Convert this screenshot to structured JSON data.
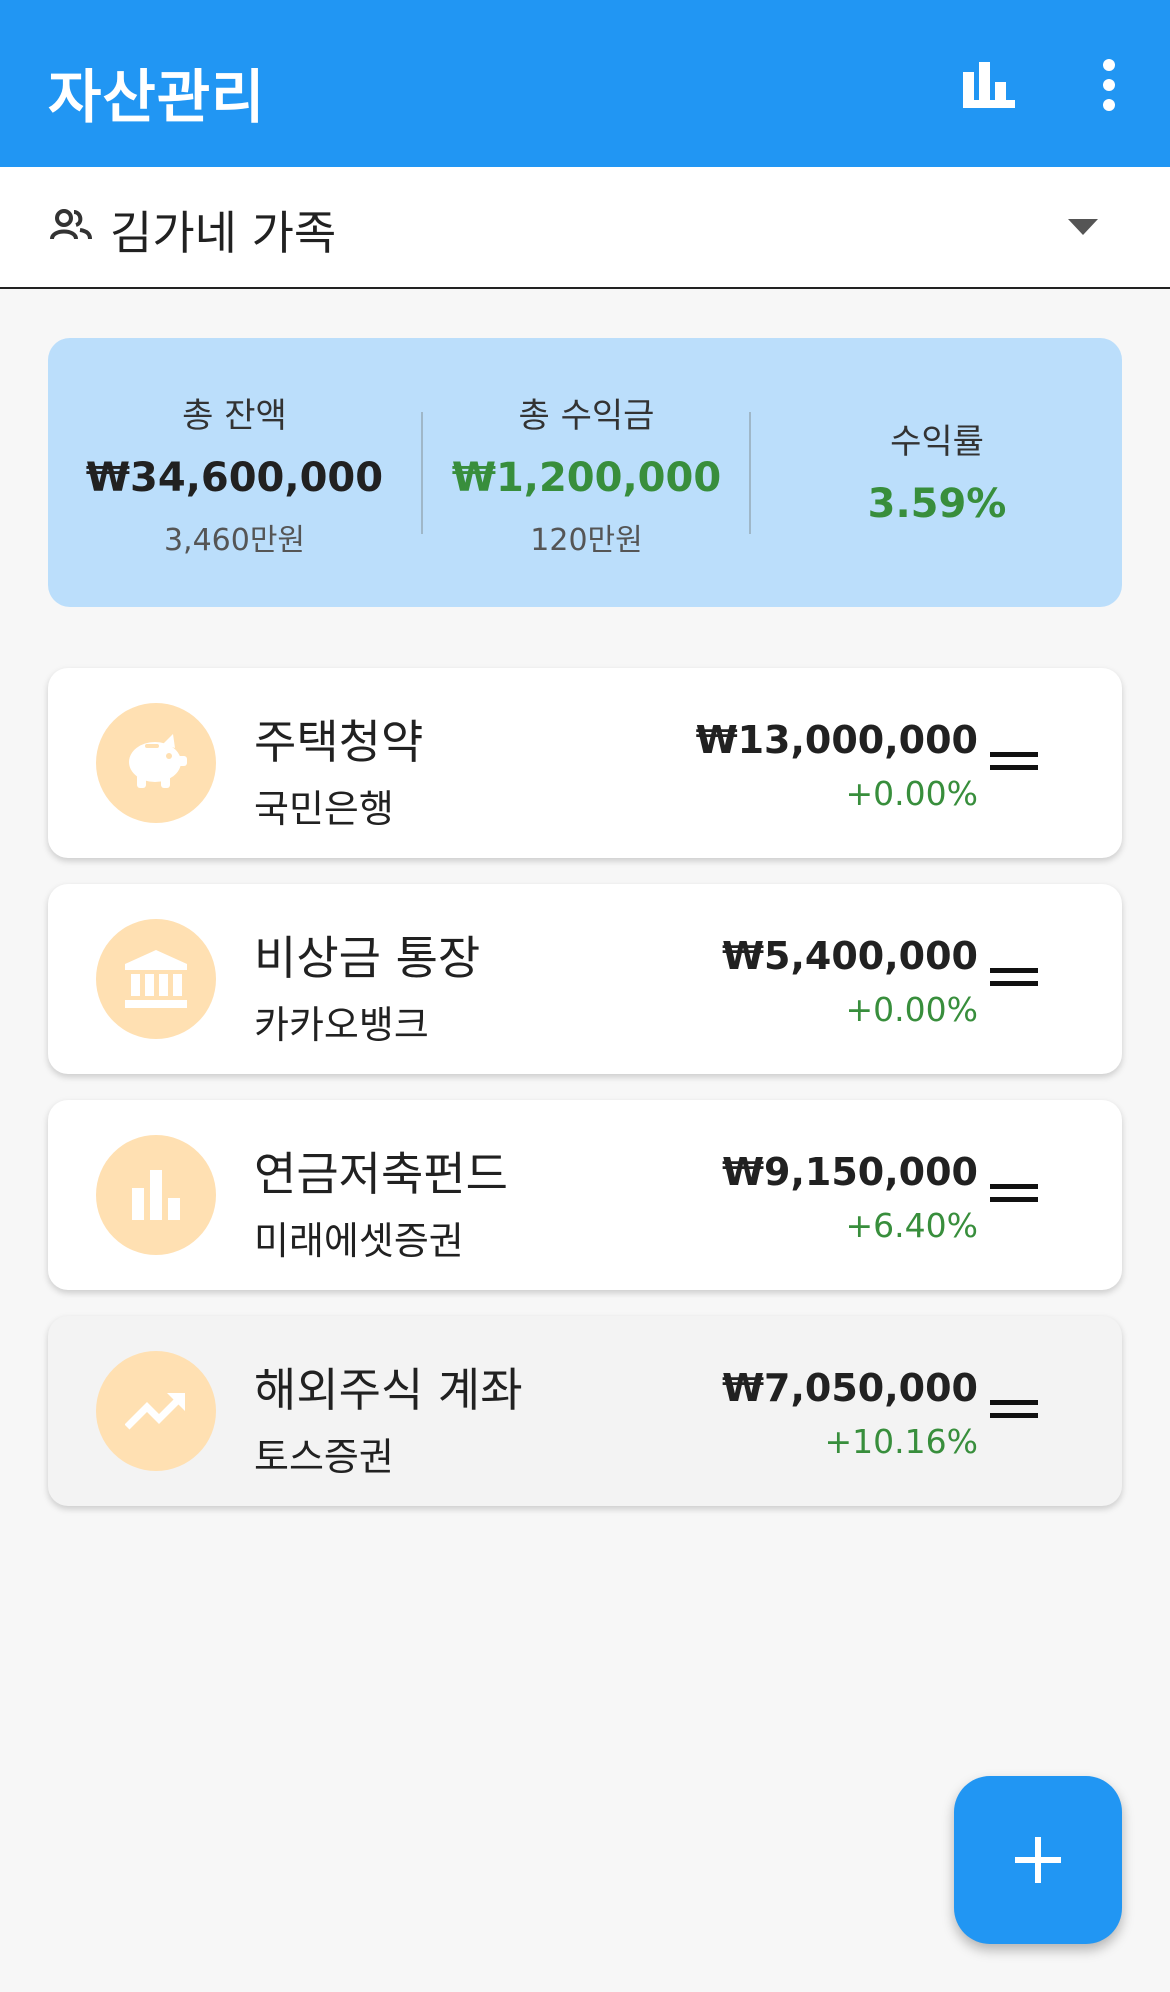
{
  "appbar": {
    "title": "자산관리",
    "actions": [
      "bar-chart-icon",
      "more-vert-icon"
    ],
    "color": "#2196f3"
  },
  "group": {
    "icon": "people-icon",
    "name": "김가네 가족",
    "dropdown_icon": "arrow-drop-down-icon"
  },
  "summary": {
    "total_balance": {
      "label": "총 잔액",
      "value": "₩34,600,000",
      "sub": "3,460만원"
    },
    "total_profit": {
      "label": "총 수익금",
      "value": "₩1,200,000",
      "sub": "120만원"
    },
    "return_rate": {
      "label": "수익률",
      "value": "3.59%"
    },
    "profit_color": "#388e3c",
    "background": "#bbdefb"
  },
  "accounts": [
    {
      "name": "주택청약",
      "bank": "국민은행",
      "amount": "₩13,000,000",
      "rate": "+0.00%",
      "icon": "piggy-bank-icon"
    },
    {
      "name": "비상금 통장",
      "bank": "카카오뱅크",
      "amount": "₩5,400,000",
      "rate": "+0.00%",
      "icon": "bank-icon"
    },
    {
      "name": "연금저축펀드",
      "bank": "미래에셋증권",
      "amount": "₩9,150,000",
      "rate": "+6.40%",
      "icon": "bar-chart-icon"
    },
    {
      "name": "해외주식 계좌",
      "bank": "토스증권",
      "amount": "₩7,050,000",
      "rate": "+10.16%",
      "icon": "trending-up-icon"
    }
  ],
  "fab": {
    "icon": "add-icon"
  }
}
